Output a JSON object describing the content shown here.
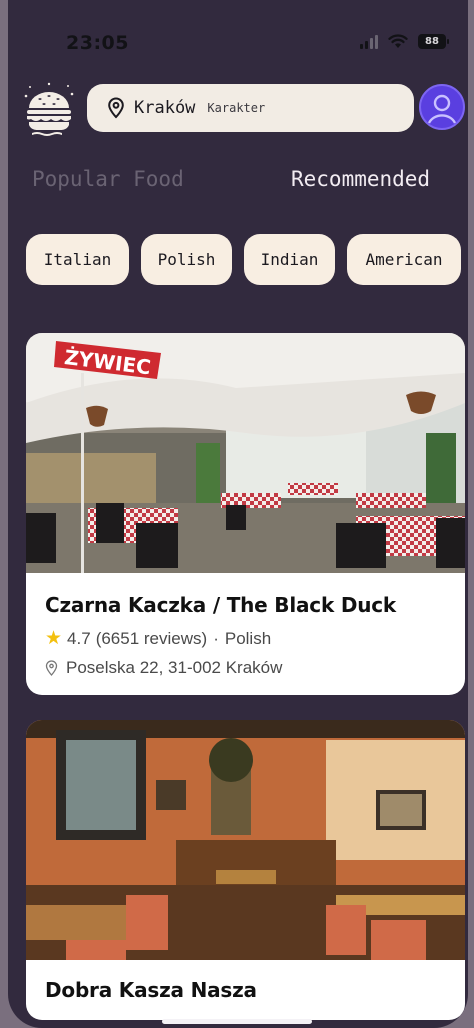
{
  "status_bar": {
    "time": "23:05",
    "battery": "88",
    "signal_icon": "cellular-signal-icon",
    "wifi_icon": "wifi-icon"
  },
  "header": {
    "logo_icon": "burger-logo-icon",
    "location": {
      "city": "Kraków",
      "district": "Karakter",
      "pin_icon": "location-pin-icon"
    },
    "avatar_icon": "user-avatar-icon"
  },
  "tabs": [
    {
      "label": "Popular Food",
      "active": false
    },
    {
      "label": "Recommended",
      "active": true
    }
  ],
  "categories": [
    "Italian",
    "Polish",
    "Indian",
    "American"
  ],
  "restaurants": [
    {
      "name": "Czarna Kaczka / The Black Duck",
      "rating": "4.7",
      "reviews": "(6651 reviews)",
      "cuisine": "Polish",
      "address": "Poselska 22, 31-002 Kraków",
      "image_signage": "ŻYWIEC"
    },
    {
      "name": "Dobra Kasza Nasza"
    }
  ],
  "colors": {
    "background": "#322a3e",
    "accent": "#5a3fe0",
    "chip": "#f8eee2",
    "star": "#f3c010"
  }
}
